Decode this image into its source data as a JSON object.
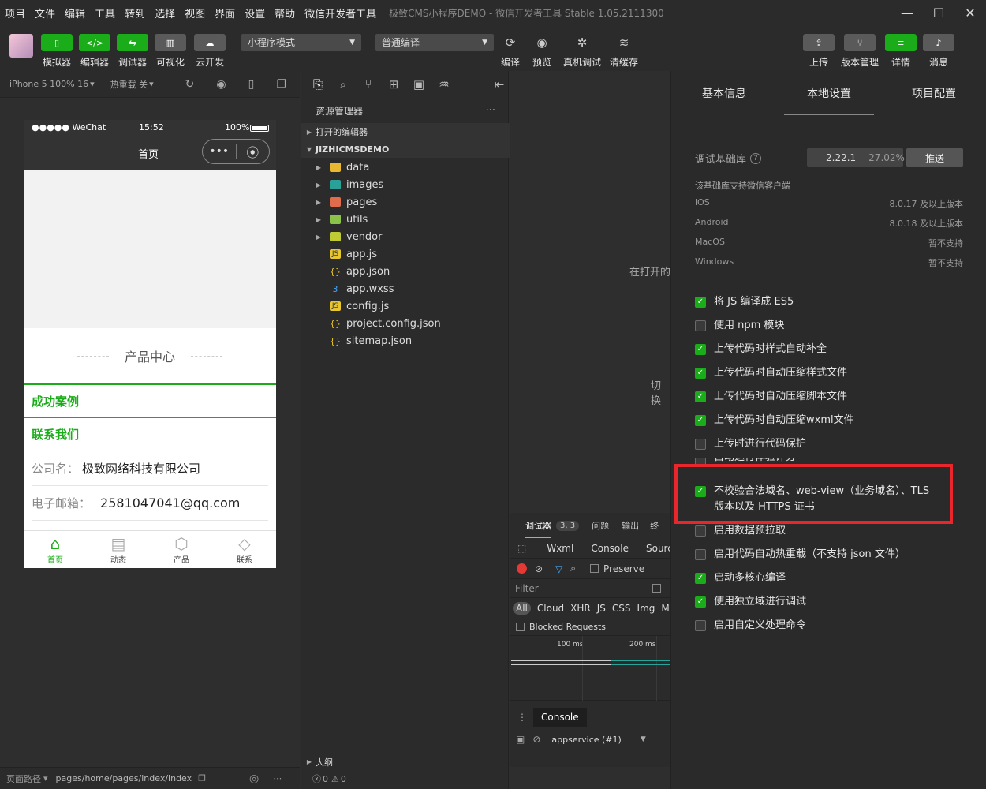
{
  "menu": [
    "项目",
    "文件",
    "编辑",
    "工具",
    "转到",
    "选择",
    "视图",
    "界面",
    "设置",
    "帮助",
    "微信开发者工具"
  ],
  "window_title": "极致CMS小程序DEMO - 微信开发者工具 Stable 1.05.2111300",
  "toolbar": {
    "simulator": "模拟器",
    "editor": "编辑器",
    "debugger": "调试器",
    "visual": "可视化",
    "cloud": "云开发",
    "mode": "小程序模式",
    "compile_mode": "普通编译",
    "compile": "编译",
    "preview": "预览",
    "remote_debug": "真机调试",
    "clear_cache": "清缓存",
    "upload": "上传",
    "version": "版本管理",
    "detail": "详情",
    "message": "消息"
  },
  "simbar": {
    "device": "iPhone 5 100% 16",
    "hot_reload": "热重载 关"
  },
  "phone": {
    "carrier": "●●●●● WeChat",
    "time": "15:52",
    "battery": "100%",
    "nav_title": "首页",
    "product_center": "产品中心",
    "case_title": "成功案例",
    "contact_title": "联系我们",
    "company_label": "公司名：",
    "company_value": "极致网络科技有限公司",
    "email_label": "电子邮箱：",
    "email_value": "2581047041@qq.com",
    "tabs": [
      "首页",
      "动态",
      "产品",
      "联系"
    ]
  },
  "pathbar": {
    "label": "页面路径",
    "path": "pages/home/pages/index/index"
  },
  "explorer": {
    "title": "资源管理器",
    "open_editors": "打开的编辑器",
    "project": "JIZHICMSDEMO",
    "folders": [
      "data",
      "images",
      "pages",
      "utils",
      "vendor"
    ],
    "files": [
      "app.js",
      "app.json",
      "app.wxss",
      "config.js",
      "project.config.json",
      "sitemap.json"
    ],
    "outline": "大纲",
    "errors": "0",
    "warnings": "0"
  },
  "editor": {
    "hint1": "在打开的",
    "hint2": "切换"
  },
  "debugger": {
    "tab_debugger": "调试器",
    "badge": "3, 3",
    "tab_issues": "问题",
    "tab_output": "输出",
    "tab_terminal": "终",
    "wxml": "Wxml",
    "console": "Console",
    "sources": "Sourc",
    "preserve": "Preserve",
    "filter": "Filter",
    "types": [
      "All",
      "Cloud",
      "XHR",
      "JS",
      "CSS",
      "Img",
      "M"
    ],
    "blocked": "Blocked Requests",
    "t1": "100 ms",
    "t2": "200 ms",
    "console_tab": "Console",
    "context": "appservice (#1)"
  },
  "settings": {
    "tabs": [
      "基本信息",
      "本地设置",
      "项目配置"
    ],
    "lib_label": "调试基础库",
    "lib_version": "2.22.1",
    "lib_percent": "27.02%",
    "push": "推送",
    "support_title": "该基础库支持微信客户端",
    "platforms": [
      {
        "name": "iOS",
        "value": "8.0.17 及以上版本"
      },
      {
        "name": "Android",
        "value": "8.0.18 及以上版本"
      },
      {
        "name": "MacOS",
        "value": "暂不支持"
      },
      {
        "name": "Windows",
        "value": "暂不支持"
      }
    ],
    "options": [
      {
        "label": "将 JS 编译成 ES5",
        "checked": true
      },
      {
        "label": "使用 npm 模块",
        "checked": false
      },
      {
        "label": "上传代码时样式自动补全",
        "checked": true
      },
      {
        "label": "上传代码时自动压缩样式文件",
        "checked": true
      },
      {
        "label": "上传代码时自动压缩脚本文件",
        "checked": true
      },
      {
        "label": "上传代码时自动压缩wxml文件",
        "checked": true
      },
      {
        "label": "上传时进行代码保护",
        "checked": false
      },
      {
        "label": "自动运行体验评分",
        "checked": false
      },
      {
        "label": "不校验合法域名、web-view（业务域名）、TLS 版本以及 HTTPS 证书",
        "checked": true
      },
      {
        "label": "启用数据预拉取",
        "checked": false
      },
      {
        "label": "启用代码自动热重载（不支持 json 文件）",
        "checked": false
      },
      {
        "label": "启动多核心编译",
        "checked": true
      },
      {
        "label": "使用独立域进行调试",
        "checked": true
      },
      {
        "label": "启用自定义处理命令",
        "checked": false
      }
    ]
  },
  "colors": {
    "accent": "#1aad19",
    "highlight": "#e8262b"
  }
}
